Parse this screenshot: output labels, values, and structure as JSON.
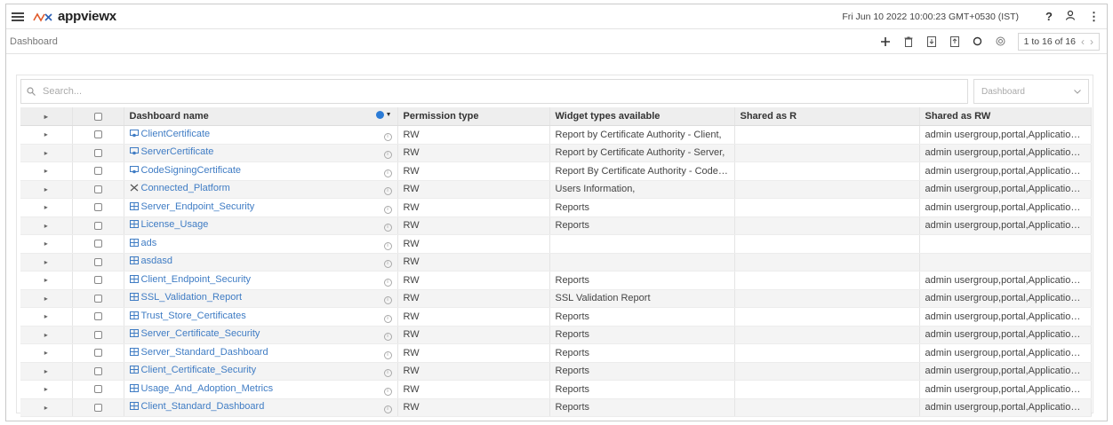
{
  "app": {
    "logo_text": "appviewx",
    "datetime": "Fri Jun 10 2022 10:00:23 GMT+0530 (IST)",
    "help_label": "?",
    "more_label": "⋮"
  },
  "breadcrumb": "Dashboard",
  "toolbar": {
    "pager_text": "1 to 16 of 16",
    "prev_label": "‹",
    "next_label": "›"
  },
  "search": {
    "placeholder": "Search...",
    "scope_placeholder": "Dashboard"
  },
  "table": {
    "headers": {
      "name": "Dashboard name",
      "permission": "Permission type",
      "widgets": "Widget types available",
      "shared_r": "Shared as R",
      "shared_rw": "Shared as RW"
    },
    "rows": [
      {
        "name": "ClientCertificate",
        "icon": "certificate-icon",
        "permission": "RW",
        "widgets": "Report by Certificate Authority - Client,",
        "shared_r": "",
        "shared_rw": "admin usergroup,portal,ApplicationM..."
      },
      {
        "name": "ServerCertificate",
        "icon": "certificate-icon",
        "permission": "RW",
        "widgets": "Report by Certificate Authority - Server,",
        "shared_r": "",
        "shared_rw": "admin usergroup,portal,ApplicationM..."
      },
      {
        "name": "CodeSigningCertificate",
        "icon": "certificate-icon",
        "permission": "RW",
        "widgets": "Report By Certificate Authority - CodeSi(",
        "shared_r": "",
        "shared_rw": "admin usergroup,portal,ApplicationM..."
      },
      {
        "name": "Connected_Platform",
        "icon": "connect-icon",
        "permission": "RW",
        "widgets": "Users Information,",
        "shared_r": "",
        "shared_rw": "admin usergroup,portal,ApplicationM..."
      },
      {
        "name": "Server_Endpoint_Security",
        "icon": "grid-icon",
        "permission": "RW",
        "widgets": "Reports",
        "shared_r": "",
        "shared_rw": "admin usergroup,portal,ApplicationM..."
      },
      {
        "name": "License_Usage",
        "icon": "grid-icon",
        "permission": "RW",
        "widgets": "Reports",
        "shared_r": "",
        "shared_rw": "admin usergroup,portal,ApplicationM..."
      },
      {
        "name": "ads",
        "icon": "grid-icon",
        "permission": "RW",
        "widgets": "",
        "shared_r": "",
        "shared_rw": ""
      },
      {
        "name": "asdasd",
        "icon": "grid-icon",
        "permission": "RW",
        "widgets": "",
        "shared_r": "",
        "shared_rw": ""
      },
      {
        "name": "Client_Endpoint_Security",
        "icon": "grid-icon",
        "permission": "RW",
        "widgets": "Reports",
        "shared_r": "",
        "shared_rw": "admin usergroup,portal,ApplicationM..."
      },
      {
        "name": "SSL_Validation_Report",
        "icon": "grid-icon",
        "permission": "RW",
        "widgets": "SSL Validation Report",
        "shared_r": "",
        "shared_rw": "admin usergroup,portal,ApplicationM..."
      },
      {
        "name": "Trust_Store_Certificates",
        "icon": "grid-icon",
        "permission": "RW",
        "widgets": "Reports",
        "shared_r": "",
        "shared_rw": "admin usergroup,portal,ApplicationM..."
      },
      {
        "name": "Server_Certificate_Security",
        "icon": "grid-icon",
        "permission": "RW",
        "widgets": "Reports",
        "shared_r": "",
        "shared_rw": "admin usergroup,portal,ApplicationM..."
      },
      {
        "name": "Server_Standard_Dashboard",
        "icon": "grid-icon",
        "permission": "RW",
        "widgets": "Reports",
        "shared_r": "",
        "shared_rw": "admin usergroup,portal,ApplicationM..."
      },
      {
        "name": "Client_Certificate_Security",
        "icon": "grid-icon",
        "permission": "RW",
        "widgets": "Reports",
        "shared_r": "",
        "shared_rw": "admin usergroup,portal,ApplicationM..."
      },
      {
        "name": "Usage_And_Adoption_Metrics",
        "icon": "grid-icon",
        "permission": "RW",
        "widgets": "Reports",
        "shared_r": "",
        "shared_rw": "admin usergroup,portal,ApplicationM..."
      },
      {
        "name": "Client_Standard_Dashboard",
        "icon": "grid-icon",
        "permission": "RW",
        "widgets": "Reports",
        "shared_r": "",
        "shared_rw": "admin usergroup,portal,ApplicationM..."
      }
    ]
  },
  "colors": {
    "link": "#3f7cc4",
    "header_bg": "#eeeeee",
    "stripe": "#f4f4f4",
    "accent": "#2b7bd6"
  }
}
